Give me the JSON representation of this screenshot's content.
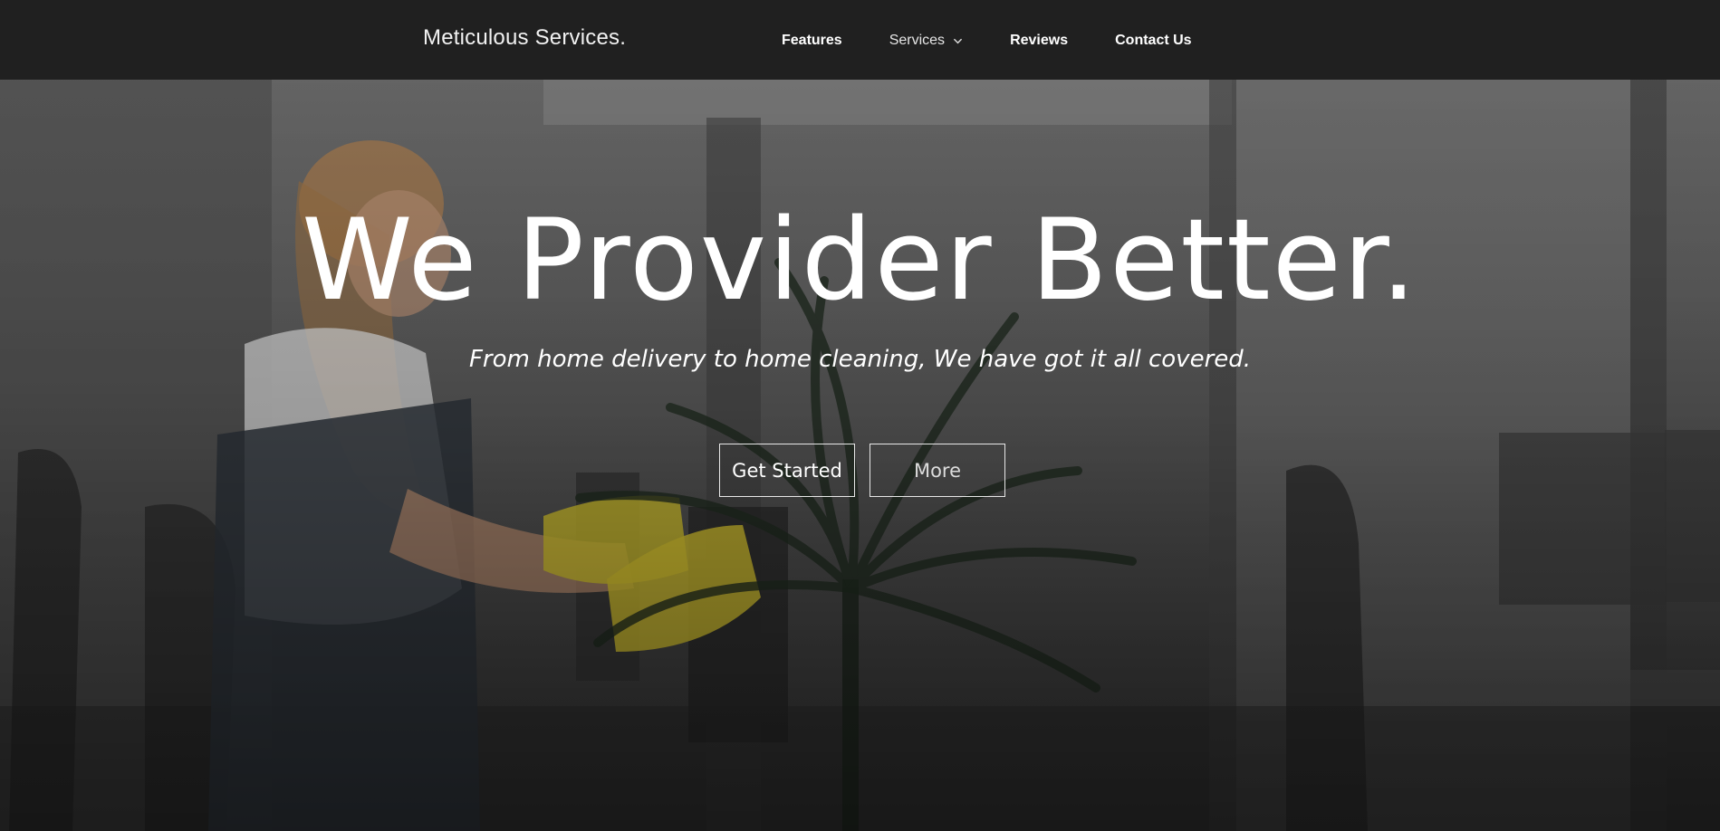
{
  "navbar": {
    "brand": "Meticulous Services.",
    "links": [
      {
        "label": "Features"
      },
      {
        "label": "Services",
        "icon": "chevron-down-icon"
      },
      {
        "label": "Reviews"
      },
      {
        "label": "Contact Us"
      }
    ]
  },
  "hero": {
    "title": "We Provider Better.",
    "subtitle": "From home delivery to home cleaning, We have got it all covered.",
    "buttons": {
      "primary": "Get Started",
      "secondary": "More"
    }
  },
  "colors": {
    "navbar_bg": "#1e1e1e",
    "text": "#ffffff",
    "button_border": "#e8e8e8"
  }
}
